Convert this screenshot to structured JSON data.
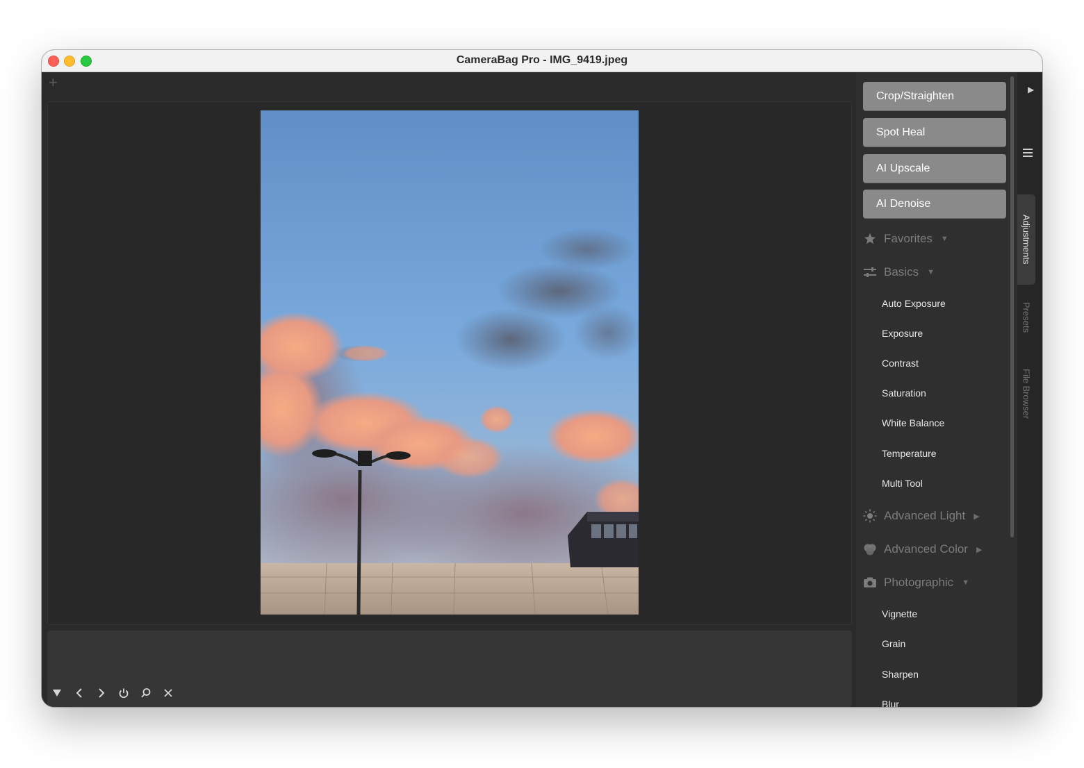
{
  "window": {
    "title": "CameraBag Pro - IMG_9419.jpeg"
  },
  "toolbar": {
    "add_icon": "+"
  },
  "tool_buttons": [
    "Crop/Straighten",
    "Spot Heal",
    "AI Upscale",
    "AI Denoise"
  ],
  "sections": {
    "favorites": {
      "label": "Favorites",
      "icon": "star-icon",
      "state": "collapsed-down"
    },
    "basics": {
      "label": "Basics",
      "icon": "sliders-icon",
      "state": "expanded",
      "items": [
        "Auto Exposure",
        "Exposure",
        "Contrast",
        "Saturation",
        "White Balance",
        "Temperature",
        "Multi Tool"
      ]
    },
    "advanced_light": {
      "label": "Advanced Light",
      "icon": "sun-icon",
      "state": "collapsed"
    },
    "advanced_color": {
      "label": "Advanced Color",
      "icon": "color-circles-icon",
      "state": "collapsed"
    },
    "photographic": {
      "label": "Photographic",
      "icon": "camera-icon",
      "state": "expanded",
      "items": [
        "Vignette",
        "Grain",
        "Sharpen",
        "Blur"
      ]
    }
  },
  "side_tabs": [
    "Adjustments",
    "Presets",
    "File Browser"
  ],
  "bottom_controls": [
    "collapse-triangle-icon",
    "previous-icon",
    "next-icon",
    "power-icon",
    "search-icon",
    "close-icon"
  ],
  "colors": {
    "tool_button": "#8a8a8a",
    "background": "#2a2a2a",
    "panel": "#2f2f2f"
  }
}
